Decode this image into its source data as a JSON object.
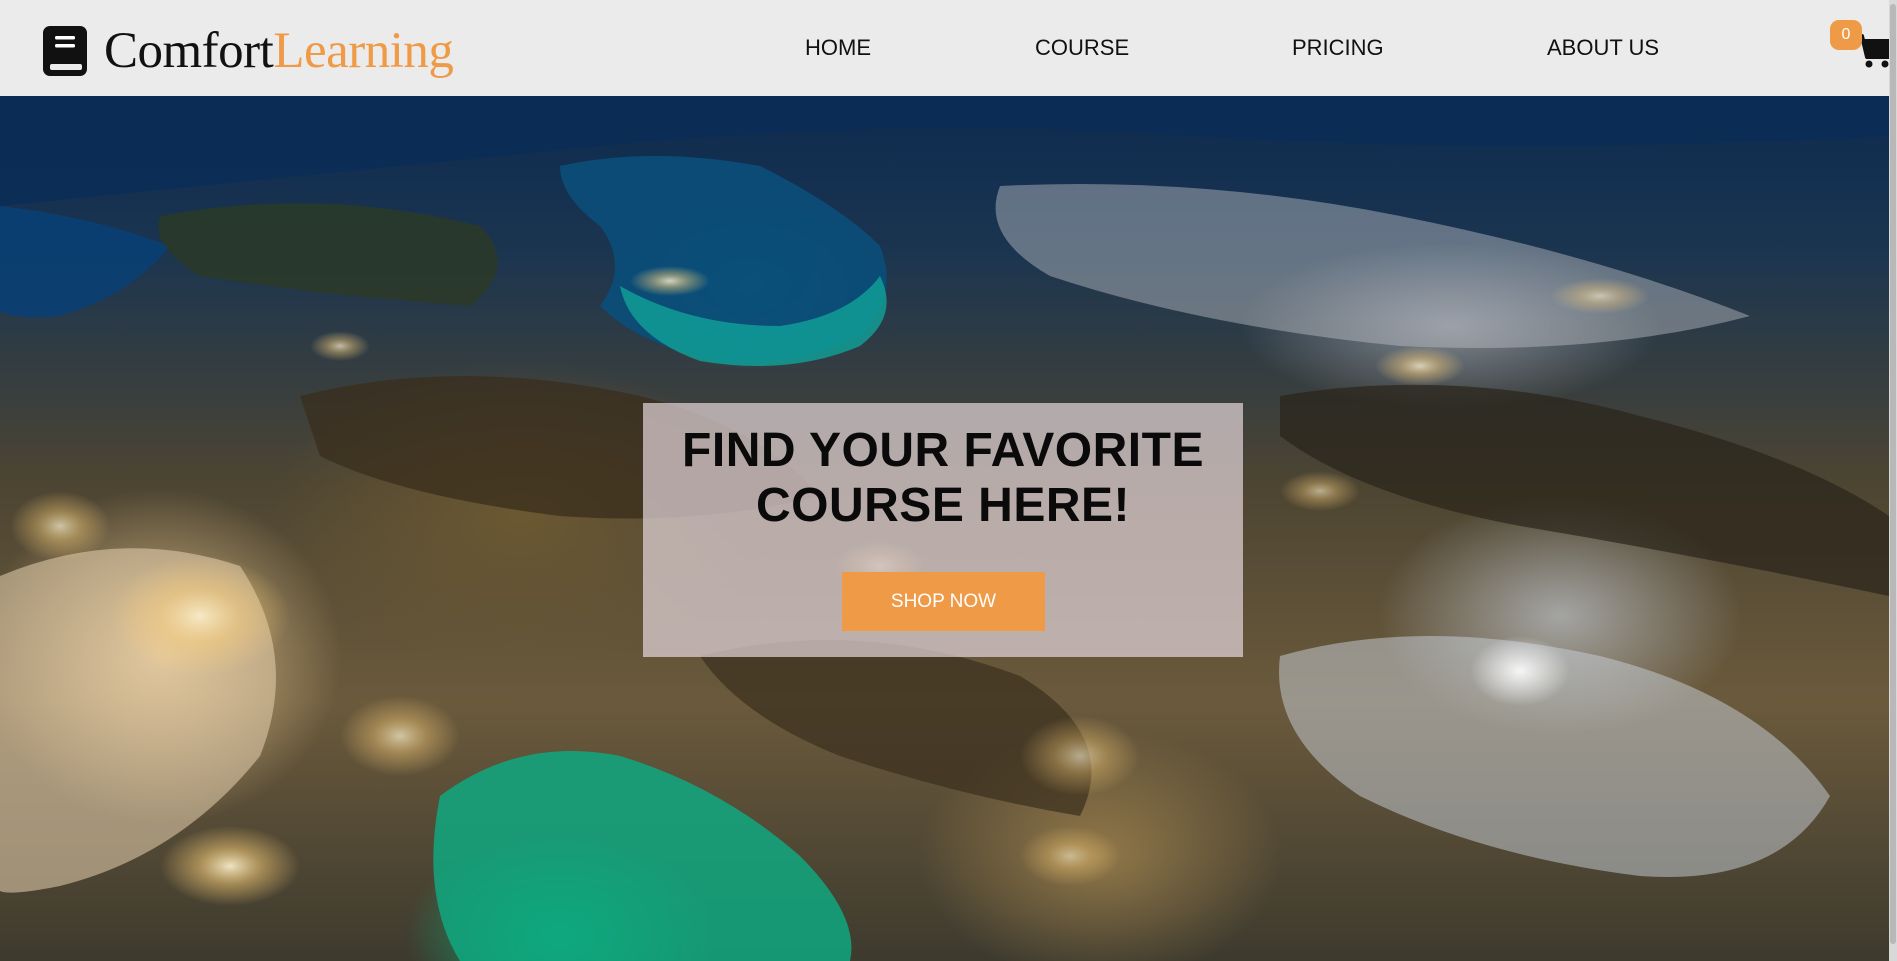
{
  "brand": {
    "name_part1": "Comfort",
    "name_part2": "Learning",
    "icon": "book-icon"
  },
  "nav": {
    "items": [
      {
        "label": "HOME"
      },
      {
        "label": "COURSE"
      },
      {
        "label": "PRICING"
      },
      {
        "label": "ABOUT US"
      }
    ]
  },
  "cart": {
    "count": "0",
    "icon": "cart-icon"
  },
  "hero": {
    "title_line1": "FIND YOUR FAVORITE",
    "title_line2": "COURSE HERE!",
    "cta_label": "SHOP NOW",
    "background": "satellite-earth-night-image"
  },
  "colors": {
    "accent": "#ef9a47",
    "header_bg": "#ebebeb",
    "text": "#111111",
    "overlay": "#e1d2d7"
  }
}
